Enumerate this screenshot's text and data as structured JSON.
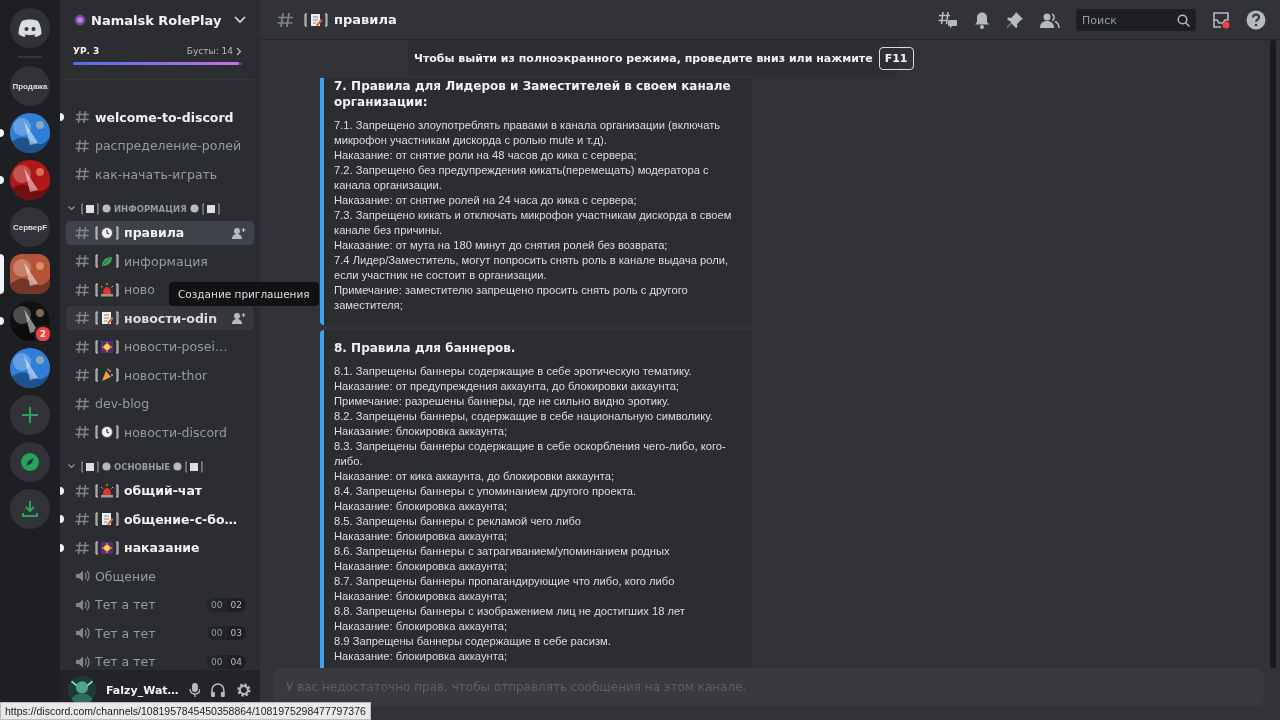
{
  "servers": [
    {
      "kind": "home",
      "selected": false,
      "unread": false
    },
    {
      "kind": "text",
      "label": "Продажа",
      "selected": false,
      "unread": false
    },
    {
      "kind": "picture",
      "selected": false,
      "unread": true
    },
    {
      "kind": "picture",
      "selected": false,
      "unread": true
    },
    {
      "kind": "text",
      "label": "СерверF",
      "selected": false,
      "unread": false
    },
    {
      "kind": "picture",
      "selected": true,
      "unread": false
    },
    {
      "kind": "picture",
      "selected": false,
      "unread": true,
      "badge": "2"
    },
    {
      "kind": "picture",
      "selected": false,
      "unread": false
    },
    {
      "kind": "add",
      "selected": false,
      "unread": false
    },
    {
      "kind": "explore",
      "selected": false,
      "unread": false
    },
    {
      "kind": "download",
      "selected": false,
      "unread": false
    }
  ],
  "server": {
    "name": "Namalsk RolePlay",
    "level": "УР. 3",
    "boosts": "Бусты: 14",
    "boost_progress": {
      "level": 0.98
    }
  },
  "channels": [
    {
      "kind": "text",
      "name": "welcome-to-discord",
      "unread": true,
      "selected": false,
      "hovered": false
    },
    {
      "kind": "text",
      "name": "распределение-ролей",
      "unread": false,
      "selected": false,
      "hovered": false
    },
    {
      "kind": "text",
      "name": "как-начать-играть",
      "unread": false,
      "selected": false,
      "hovered": false
    },
    {
      "kind": "category",
      "name": "ИНФОРМАЦИЯ",
      "expanded": true
    },
    {
      "kind": "text",
      "has_emoji": true,
      "name": "правила",
      "unread": false,
      "selected": true,
      "hovered": false
    },
    {
      "kind": "text",
      "has_emoji": true,
      "name": "информация",
      "unread": false,
      "selected": false,
      "hovered": false
    },
    {
      "kind": "text",
      "has_emoji": true,
      "name": "ново",
      "unread": false,
      "selected": false,
      "hovered": false
    },
    {
      "kind": "text",
      "has_emoji": true,
      "name": "новости-odin",
      "unread": false,
      "selected": false,
      "hovered": true
    },
    {
      "kind": "text",
      "has_emoji": true,
      "name": "новости-posei…",
      "unread": false,
      "selected": false,
      "hovered": false
    },
    {
      "kind": "text",
      "has_emoji": true,
      "name": "новости-thor",
      "unread": false,
      "selected": false,
      "hovered": false
    },
    {
      "kind": "text",
      "name": "dev-blog",
      "unread": false,
      "selected": false,
      "hovered": false
    },
    {
      "kind": "text",
      "has_emoji": true,
      "name": "новости-discord",
      "unread": false,
      "selected": false,
      "hovered": false
    },
    {
      "kind": "category",
      "name": "ОСНОВНЫЕ",
      "expanded": true
    },
    {
      "kind": "text",
      "has_emoji": true,
      "name": "общий-чат",
      "unread": true,
      "selected": false,
      "hovered": false
    },
    {
      "kind": "text",
      "has_emoji": true,
      "name": "общение-с-бо…",
      "unread": true,
      "selected": false,
      "hovered": false
    },
    {
      "kind": "text",
      "has_emoji": true,
      "name": "наказание",
      "unread": true,
      "selected": false,
      "hovered": false
    },
    {
      "kind": "voice",
      "name": "Общение"
    },
    {
      "kind": "voice",
      "name": "Тет а тет",
      "users": "00",
      "limit": "02"
    },
    {
      "kind": "voice",
      "name": "Тет а тет",
      "users": "00",
      "limit": "03"
    },
    {
      "kind": "voice",
      "name": "Тет а тет",
      "users": "00",
      "limit": "04"
    }
  ],
  "tooltip": {
    "text": "Создание приглашения"
  },
  "user": {
    "name": "Falzy_Wat…"
  },
  "header": {
    "has_emoji": true,
    "channel": "правила",
    "search": {
      "placeholder": "Поиск"
    }
  },
  "embeds": [
    {
      "title": "7. Правила для Лидеров и Заместителей в своем канале организации:",
      "lines": [
        "7.1. Запрещено злоупотреблять правами в канала организации (включать микрофон участникам дискорда с ролью mute и т.д).",
        "Наказание: от снятие роли на 48 часов до кика с сервера;",
        "7.2. Запрещено без предупреждения кикать(перемещать) модератора с канала организации.",
        "Наказание: от снятие ролей на 24 часа до кика с сервера;",
        "7.3. Запрещено кикать и отключать микрофон участникам дискорда в своем канале без причины.",
        "Наказание: от мута на 180 минут до снятия ролей без возврата;",
        "7.4 Лидер/Заместитель, могут попросить снять роль в канале выдача роли, если участник не состоит в организации.",
        "Примечание: заместителю запрещено просить снять роль с другого заместителя;"
      ]
    },
    {
      "title": "8. Правила для баннеров.",
      "lines": [
        "8.1. Запрещены баннеры содержащие в себе эротическую тематику.",
        "Наказание: от предупреждения аккаунта, до блокировки аккаунта;",
        "Примечание: разрешены баннеры, где не сильно видно эротику.",
        "8.2. Запрещены баннеры, содержащие в себе национальную символику.",
        "Наказание: блокировка аккаунта;",
        "8.3. Запрещены баннеры содержащие в себе оскорбления чего-либо, кого-либо.",
        "Наказание: от кика аккаунта, до блокировки аккаунта;",
        "8.4. Запрещены баннеры с упоминанием другого проекта.",
        "Наказание: блокировка аккаунта;",
        "8.5. Запрещены баннеры с рекламой чего либо",
        "Наказание: блокировка аккаунта;",
        "8.6. Запрещены баннеры с затрагиванием/упоминанием родных",
        "Наказание: блокировка аккаунта;",
        "8.7. Запрещены баннеры пропагандирующие что либо, кого либо",
        "Наказание: блокировка аккаунта;",
        "8.8. Запрещены баннеры с изображением лиц не достигших 18 лет",
        "Наказание: блокировка аккаунта;",
        "8.9 Запрещены баннеры содержащие в себе расизм.",
        "Наказание: блокировка аккаунта;"
      ]
    }
  ],
  "composer": {
    "placeholder": "У вас недостаточно прав, чтобы отправлять сообщения на этом канале."
  },
  "fullscreen_notice": {
    "text": "Чтобы выйти из полноэкранного режима, проведите вниз или нажмите",
    "key": "F11"
  },
  "status_url": "https://discord.com/channels/1081957845450358864/1081975298477797376"
}
